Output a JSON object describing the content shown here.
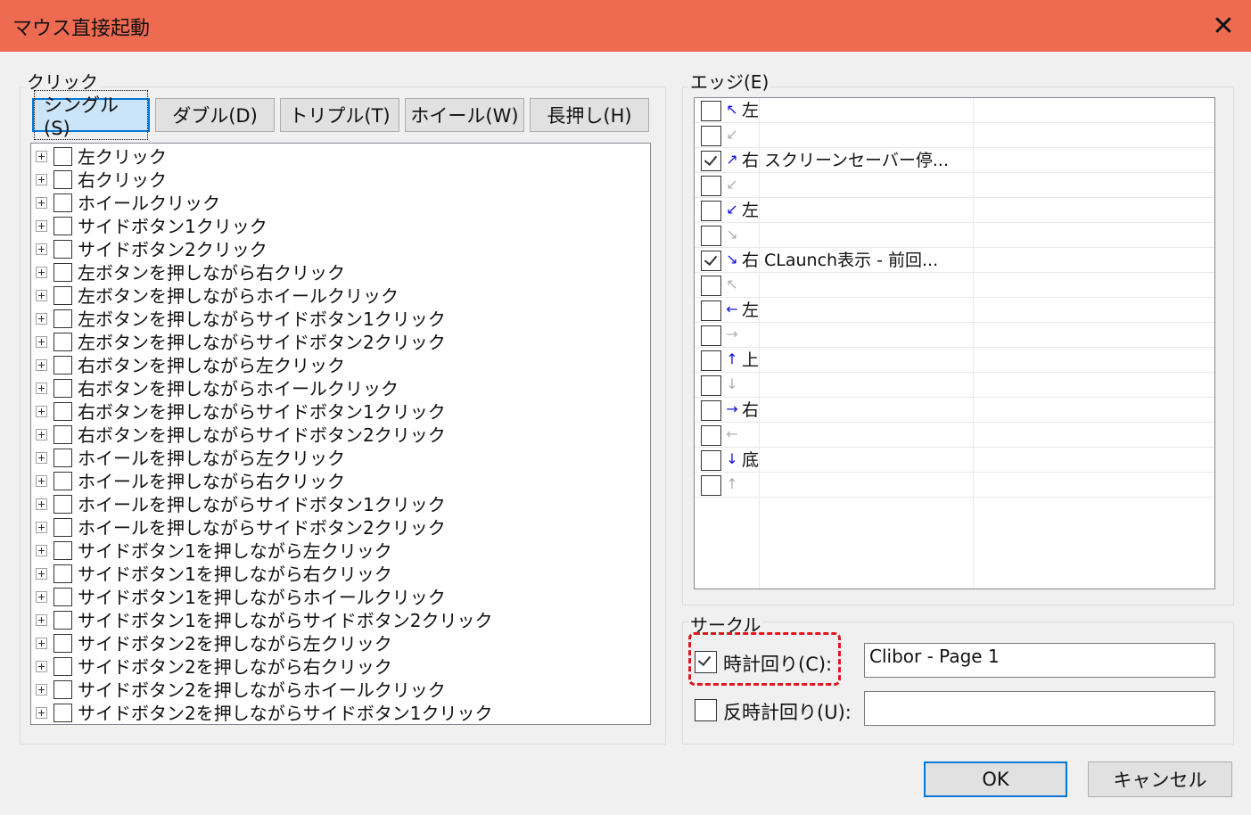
{
  "window": {
    "title": "マウス直接起動",
    "close_glyph": "✕"
  },
  "click_group": {
    "label": "クリック",
    "tabs": [
      {
        "label": "シングル(S)",
        "active": true
      },
      {
        "label": "ダブル(D)",
        "active": false
      },
      {
        "label": "トリプル(T)",
        "active": false
      },
      {
        "label": "ホイール(W)",
        "active": false
      },
      {
        "label": "長押し(H)",
        "active": false
      }
    ],
    "items": [
      "左クリック",
      "右クリック",
      "ホイールクリック",
      "サイドボタン1クリック",
      "サイドボタン2クリック",
      "左ボタンを押しながら右クリック",
      "左ボタンを押しながらホイールクリック",
      "左ボタンを押しながらサイドボタン1クリック",
      "左ボタンを押しながらサイドボタン2クリック",
      "右ボタンを押しながら左クリック",
      "右ボタンを押しながらホイールクリック",
      "右ボタンを押しながらサイドボタン1クリック",
      "右ボタンを押しながらサイドボタン2クリック",
      "ホイールを押しながら左クリック",
      "ホイールを押しながら右クリック",
      "ホイールを押しながらサイドボタン1クリック",
      "ホイールを押しながらサイドボタン2クリック",
      "サイドボタン1を押しながら左クリック",
      "サイドボタン1を押しながら右クリック",
      "サイドボタン1を押しながらホイールクリック",
      "サイドボタン1を押しながらサイドボタン2クリック",
      "サイドボタン2を押しながら左クリック",
      "サイドボタン2を押しながら右クリック",
      "サイドボタン2を押しながらホイールクリック",
      "サイドボタン2を押しながらサイドボタン1クリック"
    ]
  },
  "edge_group": {
    "label": "エッジ(E)",
    "rows": [
      {
        "checked": false,
        "arrow": "↖",
        "arrow_color": "#1010e0",
        "dir": "左",
        "action": ""
      },
      {
        "checked": false,
        "arrow": "↙",
        "arrow_color": "#b0b0b0",
        "dir": "",
        "action": ""
      },
      {
        "checked": true,
        "arrow": "↗",
        "arrow_color": "#1010e0",
        "dir": "右",
        "action": "スクリーンセーバー停..."
      },
      {
        "checked": false,
        "arrow": "↙",
        "arrow_color": "#b0b0b0",
        "dir": "",
        "action": ""
      },
      {
        "checked": false,
        "arrow": "↙",
        "arrow_color": "#1010e0",
        "dir": "左",
        "action": ""
      },
      {
        "checked": false,
        "arrow": "↘",
        "arrow_color": "#b0b0b0",
        "dir": "",
        "action": ""
      },
      {
        "checked": true,
        "arrow": "↘",
        "arrow_color": "#1010e0",
        "dir": "右",
        "action": "CLaunch表示 - 前回..."
      },
      {
        "checked": false,
        "arrow": "↖",
        "arrow_color": "#b0b0b0",
        "dir": "",
        "action": ""
      },
      {
        "checked": false,
        "arrow": "←",
        "arrow_color": "#1010e0",
        "dir": "左",
        "action": ""
      },
      {
        "checked": false,
        "arrow": "→",
        "arrow_color": "#b0b0b0",
        "dir": "",
        "action": ""
      },
      {
        "checked": false,
        "arrow": "↑",
        "arrow_color": "#1010e0",
        "dir": "上",
        "action": ""
      },
      {
        "checked": false,
        "arrow": "↓",
        "arrow_color": "#b0b0b0",
        "dir": "",
        "action": ""
      },
      {
        "checked": false,
        "arrow": "→",
        "arrow_color": "#1010e0",
        "dir": "右",
        "action": ""
      },
      {
        "checked": false,
        "arrow": "←",
        "arrow_color": "#b0b0b0",
        "dir": "",
        "action": ""
      },
      {
        "checked": false,
        "arrow": "↓",
        "arrow_color": "#1010e0",
        "dir": "底",
        "action": ""
      },
      {
        "checked": false,
        "arrow": "↑",
        "arrow_color": "#b0b0b0",
        "dir": "",
        "action": ""
      }
    ]
  },
  "circle_group": {
    "label": "サークル",
    "clockwise": {
      "label": "時計回り(C):",
      "checked": true,
      "value": "Clibor - Page 1"
    },
    "counter_clockwise": {
      "label": "反時計回り(U):",
      "checked": false,
      "value": ""
    }
  },
  "footer": {
    "ok_label": "OK",
    "cancel_label": "キャンセル"
  },
  "colors": {
    "titlebar": "#ee6b52",
    "highlight": "#e0161f",
    "accent": "#0078d7"
  }
}
